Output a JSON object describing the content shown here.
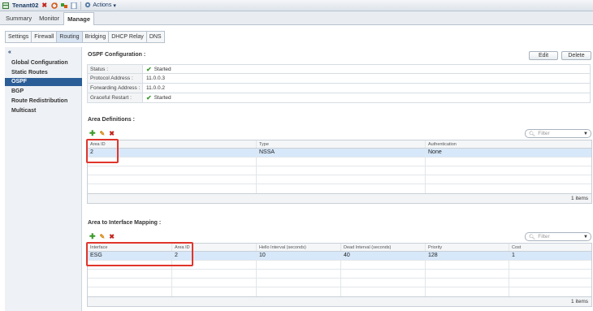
{
  "window": {
    "title": "Tenant02",
    "actions_label": "Actions"
  },
  "main_tabs": [
    {
      "label": "Summary",
      "active": false
    },
    {
      "label": "Monitor",
      "active": false
    },
    {
      "label": "Manage",
      "active": true
    }
  ],
  "sub_tabs": [
    {
      "label": "Settings",
      "active": false
    },
    {
      "label": "Firewall",
      "active": false
    },
    {
      "label": "Routing",
      "active": true
    },
    {
      "label": "Bridging",
      "active": false
    },
    {
      "label": "DHCP Relay",
      "active": false
    },
    {
      "label": "DNS",
      "active": false
    }
  ],
  "sidebar": {
    "collapse_label": "«",
    "items": [
      {
        "label": "Global Configuration",
        "active": false
      },
      {
        "label": "Static Routes",
        "active": false
      },
      {
        "label": "OSPF",
        "active": true
      },
      {
        "label": "BGP",
        "active": false
      },
      {
        "label": "Route Redistribution",
        "active": false
      },
      {
        "label": "Multicast",
        "active": false
      }
    ]
  },
  "ospf": {
    "title": "OSPF Configuration :",
    "edit_label": "Edit",
    "delete_label": "Delete",
    "fields": [
      {
        "label": "Status :",
        "value": "Started",
        "check": true
      },
      {
        "label": "Protocol Address :",
        "value": "11.0.0.3",
        "check": false
      },
      {
        "label": "Forwarding Address :",
        "value": "11.0.0.2",
        "check": false
      },
      {
        "label": "Graceful Restart :",
        "value": "Started",
        "check": true
      }
    ]
  },
  "area_definitions": {
    "title": "Area Definitions :",
    "filter_placeholder": "Filter",
    "columns": [
      "Area ID",
      "Type",
      "Authentication"
    ],
    "rows": [
      [
        "2",
        "NSSA",
        "None"
      ]
    ],
    "footer": "1 items"
  },
  "area_interface": {
    "title": "Area to Interface Mapping :",
    "filter_placeholder": "Filter",
    "columns": [
      "Interface",
      "Area ID",
      "Hello Interval (seconds)",
      "Dead Interval (seconds)",
      "Priority",
      "Cost"
    ],
    "rows": [
      [
        "ESG",
        "2",
        "10",
        "40",
        "128",
        "1"
      ]
    ],
    "footer": "1 items"
  },
  "colors": {
    "accent": "#2b5d97",
    "selected_row": "#d7e8fa",
    "highlight": "#e0352b",
    "ok": "#3b9b2f"
  }
}
